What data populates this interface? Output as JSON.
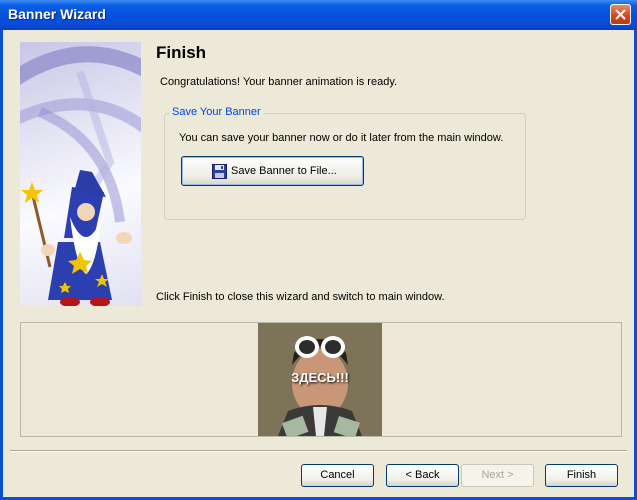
{
  "window": {
    "title": "Banner Wizard"
  },
  "page": {
    "heading": "Finish",
    "congrats": "Congratulations! Your banner animation is ready.",
    "finish_note": "Click Finish to close this wizard and switch to main window."
  },
  "save_group": {
    "legend": "Save Your Banner",
    "text": "You can save your banner now or do it later from the main window.",
    "button_label": "Save Banner to File..."
  },
  "preview": {
    "caption": "ЗДЕСЬ!!!"
  },
  "buttons": {
    "cancel": "Cancel",
    "back": "< Back",
    "next": "Next >",
    "finish": "Finish"
  },
  "colors": {
    "titlebar": "#0a4fd6",
    "legend": "#0046d5",
    "face": "#ece9d8"
  },
  "icons": {
    "close": "close-icon",
    "save": "floppy-disk-icon",
    "wizard": "wizard-illustration"
  }
}
